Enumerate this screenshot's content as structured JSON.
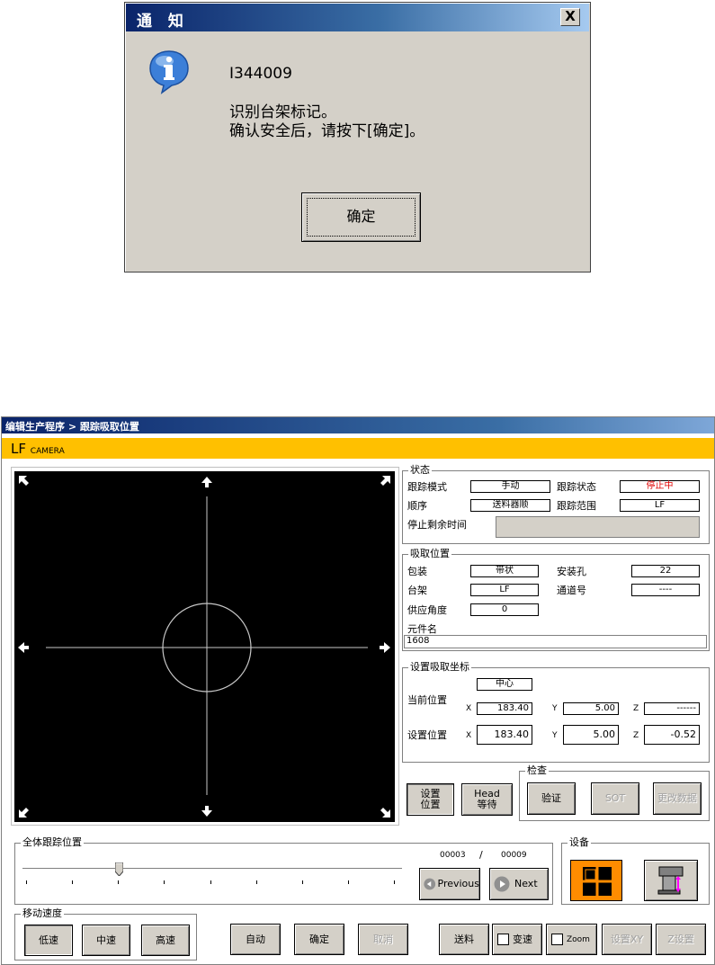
{
  "dialog": {
    "title": "通 知",
    "close_glyph": "X",
    "code": "I344009",
    "line1": "识别台架标记。",
    "line2": "确认安全后，请按下[确定]。",
    "ok_label": "确定"
  },
  "window": {
    "breadcrumb": "编辑生产程序 > 跟踪吸取位置",
    "camera_label": "LF",
    "camera_suffix": "CAMERA"
  },
  "status": {
    "group_title": "状态",
    "track_mode_label": "跟踪模式",
    "track_mode_value": "手动",
    "track_state_label": "跟踪状态",
    "track_state_value": "停止中",
    "order_label": "顺序",
    "order_value": "送料器顺",
    "track_range_label": "跟踪范围",
    "track_range_value": "LF",
    "remaining_label": "停止剩余时间",
    "remaining_value": ""
  },
  "pickup": {
    "group_title": "吸取位置",
    "package_label": "包装",
    "package_value": "带状",
    "hole_label": "安装孔",
    "hole_value": "22",
    "rack_label": "台架",
    "rack_value": "LF",
    "lane_label": "通道号",
    "lane_value": "----",
    "angle_label": "供应角度",
    "angle_value": "0",
    "part_label": "元件名",
    "part_value": "1608"
  },
  "coords": {
    "group_title": "设置吸取坐标",
    "mode_value": "中心",
    "current_label": "当前位置",
    "set_label": "设置位置",
    "x_label": "X",
    "y_label": "Y",
    "z_label": "Z",
    "current_x": "183.40",
    "current_y": "5.00",
    "current_z": "------",
    "set_x": "183.40",
    "set_y": "5.00",
    "set_z": "-0.52"
  },
  "actions": {
    "set_pos_label": "设置\n位置",
    "head_wait_label": "Head\n等待"
  },
  "check": {
    "group_title": "检查",
    "verify_label": "验证",
    "sot_label": "SOT",
    "change_data_label": "更改数据"
  },
  "tracking": {
    "group_title": "全体跟踪位置",
    "current_index": "00003",
    "separator": "/",
    "total": "00009",
    "slider_position": 0.25,
    "previous_label": "Previous",
    "next_label": "Next"
  },
  "device": {
    "group_title": "设备"
  },
  "speed": {
    "group_title": "移动速度",
    "low_label": "低速",
    "mid_label": "中速",
    "high_label": "高速"
  },
  "bottom": {
    "auto_label": "自动",
    "confirm_label": "确定",
    "cancel_label": "取消",
    "feed_label": "送料",
    "variable_speed_label": "变速",
    "zoom_label": "Zoom",
    "set_xy_label": "设置XY",
    "set_z_label": "Z设置"
  },
  "colors": {
    "camera_bar": "#ffc000",
    "device_active": "#ff8c00",
    "stopped_text": "#e00000"
  }
}
